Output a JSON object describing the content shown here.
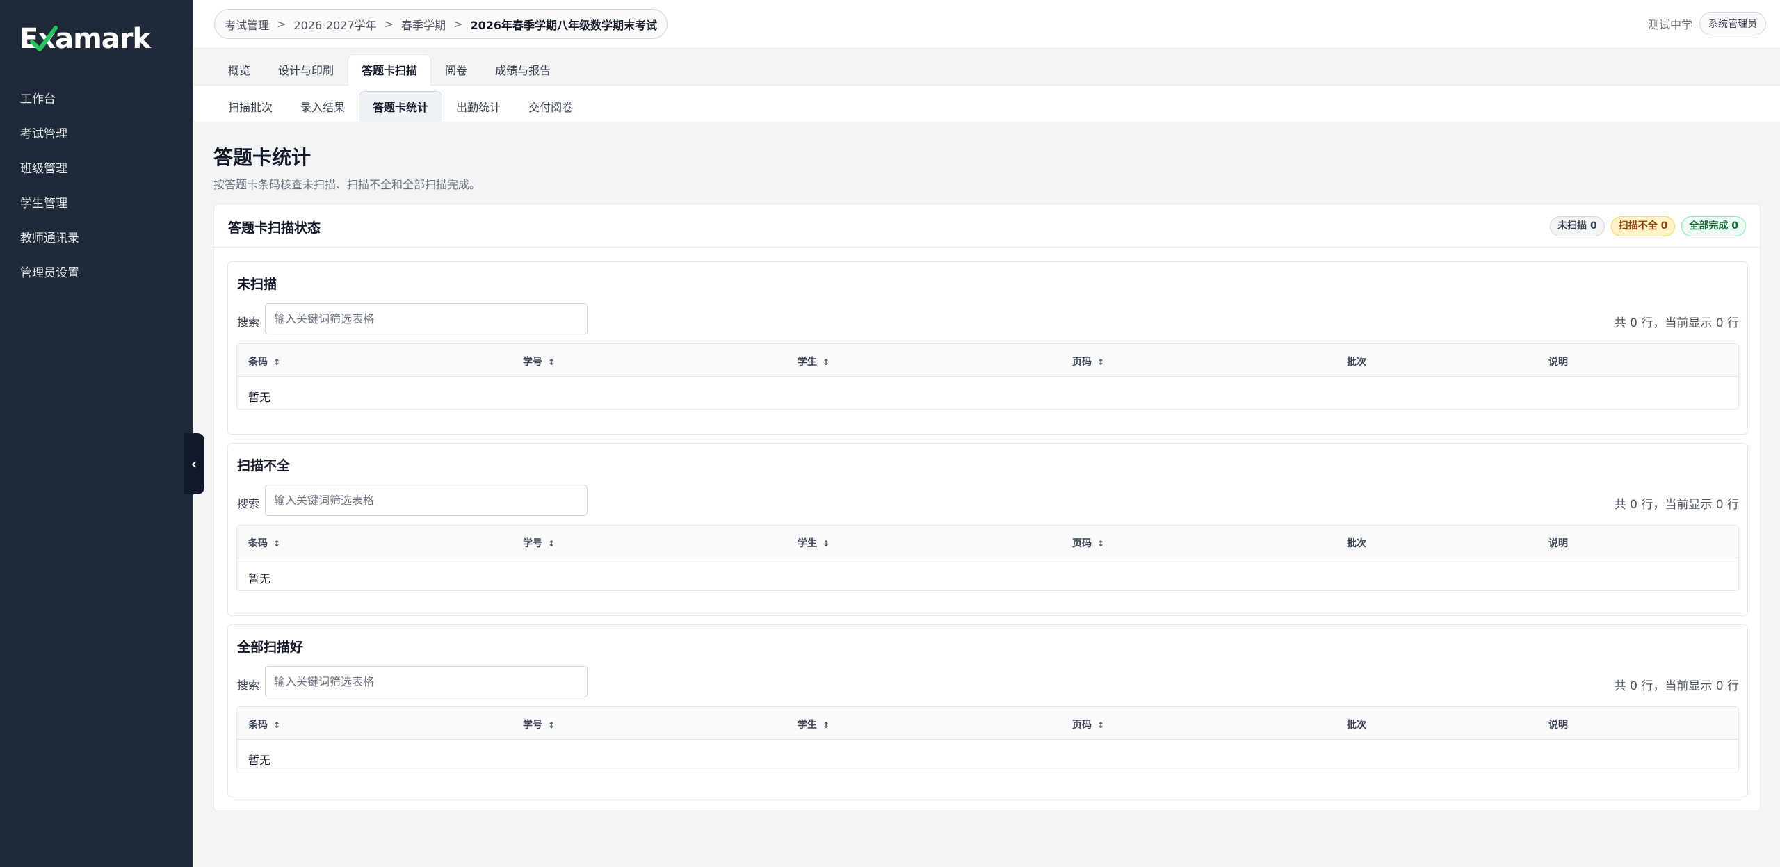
{
  "app": {
    "logo_text": "Examark"
  },
  "sidebar": {
    "items": [
      {
        "label": "工作台"
      },
      {
        "label": "考试管理"
      },
      {
        "label": "班级管理"
      },
      {
        "label": "学生管理"
      },
      {
        "label": "教师通讯录"
      },
      {
        "label": "管理员设置"
      }
    ],
    "collapse_glyph": "‹"
  },
  "breadcrumb": {
    "items": [
      "考试管理",
      "2026-2027学年",
      "春季学期",
      "2026年春季学期八年级数学期末考试"
    ],
    "separator": ">"
  },
  "header": {
    "school": "测试中学",
    "role": "系统管理员"
  },
  "tabs_primary": [
    {
      "label": "概览",
      "active": false
    },
    {
      "label": "设计与印刷",
      "active": false
    },
    {
      "label": "答题卡扫描",
      "active": true
    },
    {
      "label": "阅卷",
      "active": false
    },
    {
      "label": "成绩与报告",
      "active": false
    }
  ],
  "tabs_secondary": [
    {
      "label": "扫描批次",
      "active": false
    },
    {
      "label": "录入结果",
      "active": false
    },
    {
      "label": "答题卡统计",
      "active": true
    },
    {
      "label": "出勤统计",
      "active": false
    },
    {
      "label": "交付阅卷",
      "active": false
    }
  ],
  "page": {
    "title": "答题卡统计",
    "subtitle": "按答题卡条码核查未扫描、扫描不全和全部扫描完成。"
  },
  "card": {
    "title": "答题卡扫描状态",
    "badges": [
      {
        "label": "未扫描 0",
        "color": "#374151"
      },
      {
        "label": "扫描不全 0",
        "color": "#92400e"
      },
      {
        "label": "全部完成 0",
        "color": "#166534"
      }
    ]
  },
  "table_columns": [
    {
      "label": "条码",
      "sortable": true
    },
    {
      "label": "学号",
      "sortable": true
    },
    {
      "label": "学生",
      "sortable": true
    },
    {
      "label": "页码",
      "sortable": true
    },
    {
      "label": "批次",
      "sortable": false
    },
    {
      "label": "说明",
      "sortable": false
    }
  ],
  "sort_glyph": "↕",
  "sections": [
    {
      "title": "未扫描",
      "search_label": "搜索",
      "search_placeholder": "输入关键词筛选表格",
      "search_value": "",
      "row_count": "共 0 行，当前显示 0 行",
      "empty_text": "暂无"
    },
    {
      "title": "扫描不全",
      "search_label": "搜索",
      "search_placeholder": "输入关键词筛选表格",
      "search_value": "",
      "row_count": "共 0 行，当前显示 0 行",
      "empty_text": "暂无"
    },
    {
      "title": "全部扫描好",
      "search_label": "搜索",
      "search_placeholder": "输入关键词筛选表格",
      "search_value": "",
      "row_count": "共 0 行，当前显示 0 行",
      "empty_text": "暂无"
    }
  ]
}
